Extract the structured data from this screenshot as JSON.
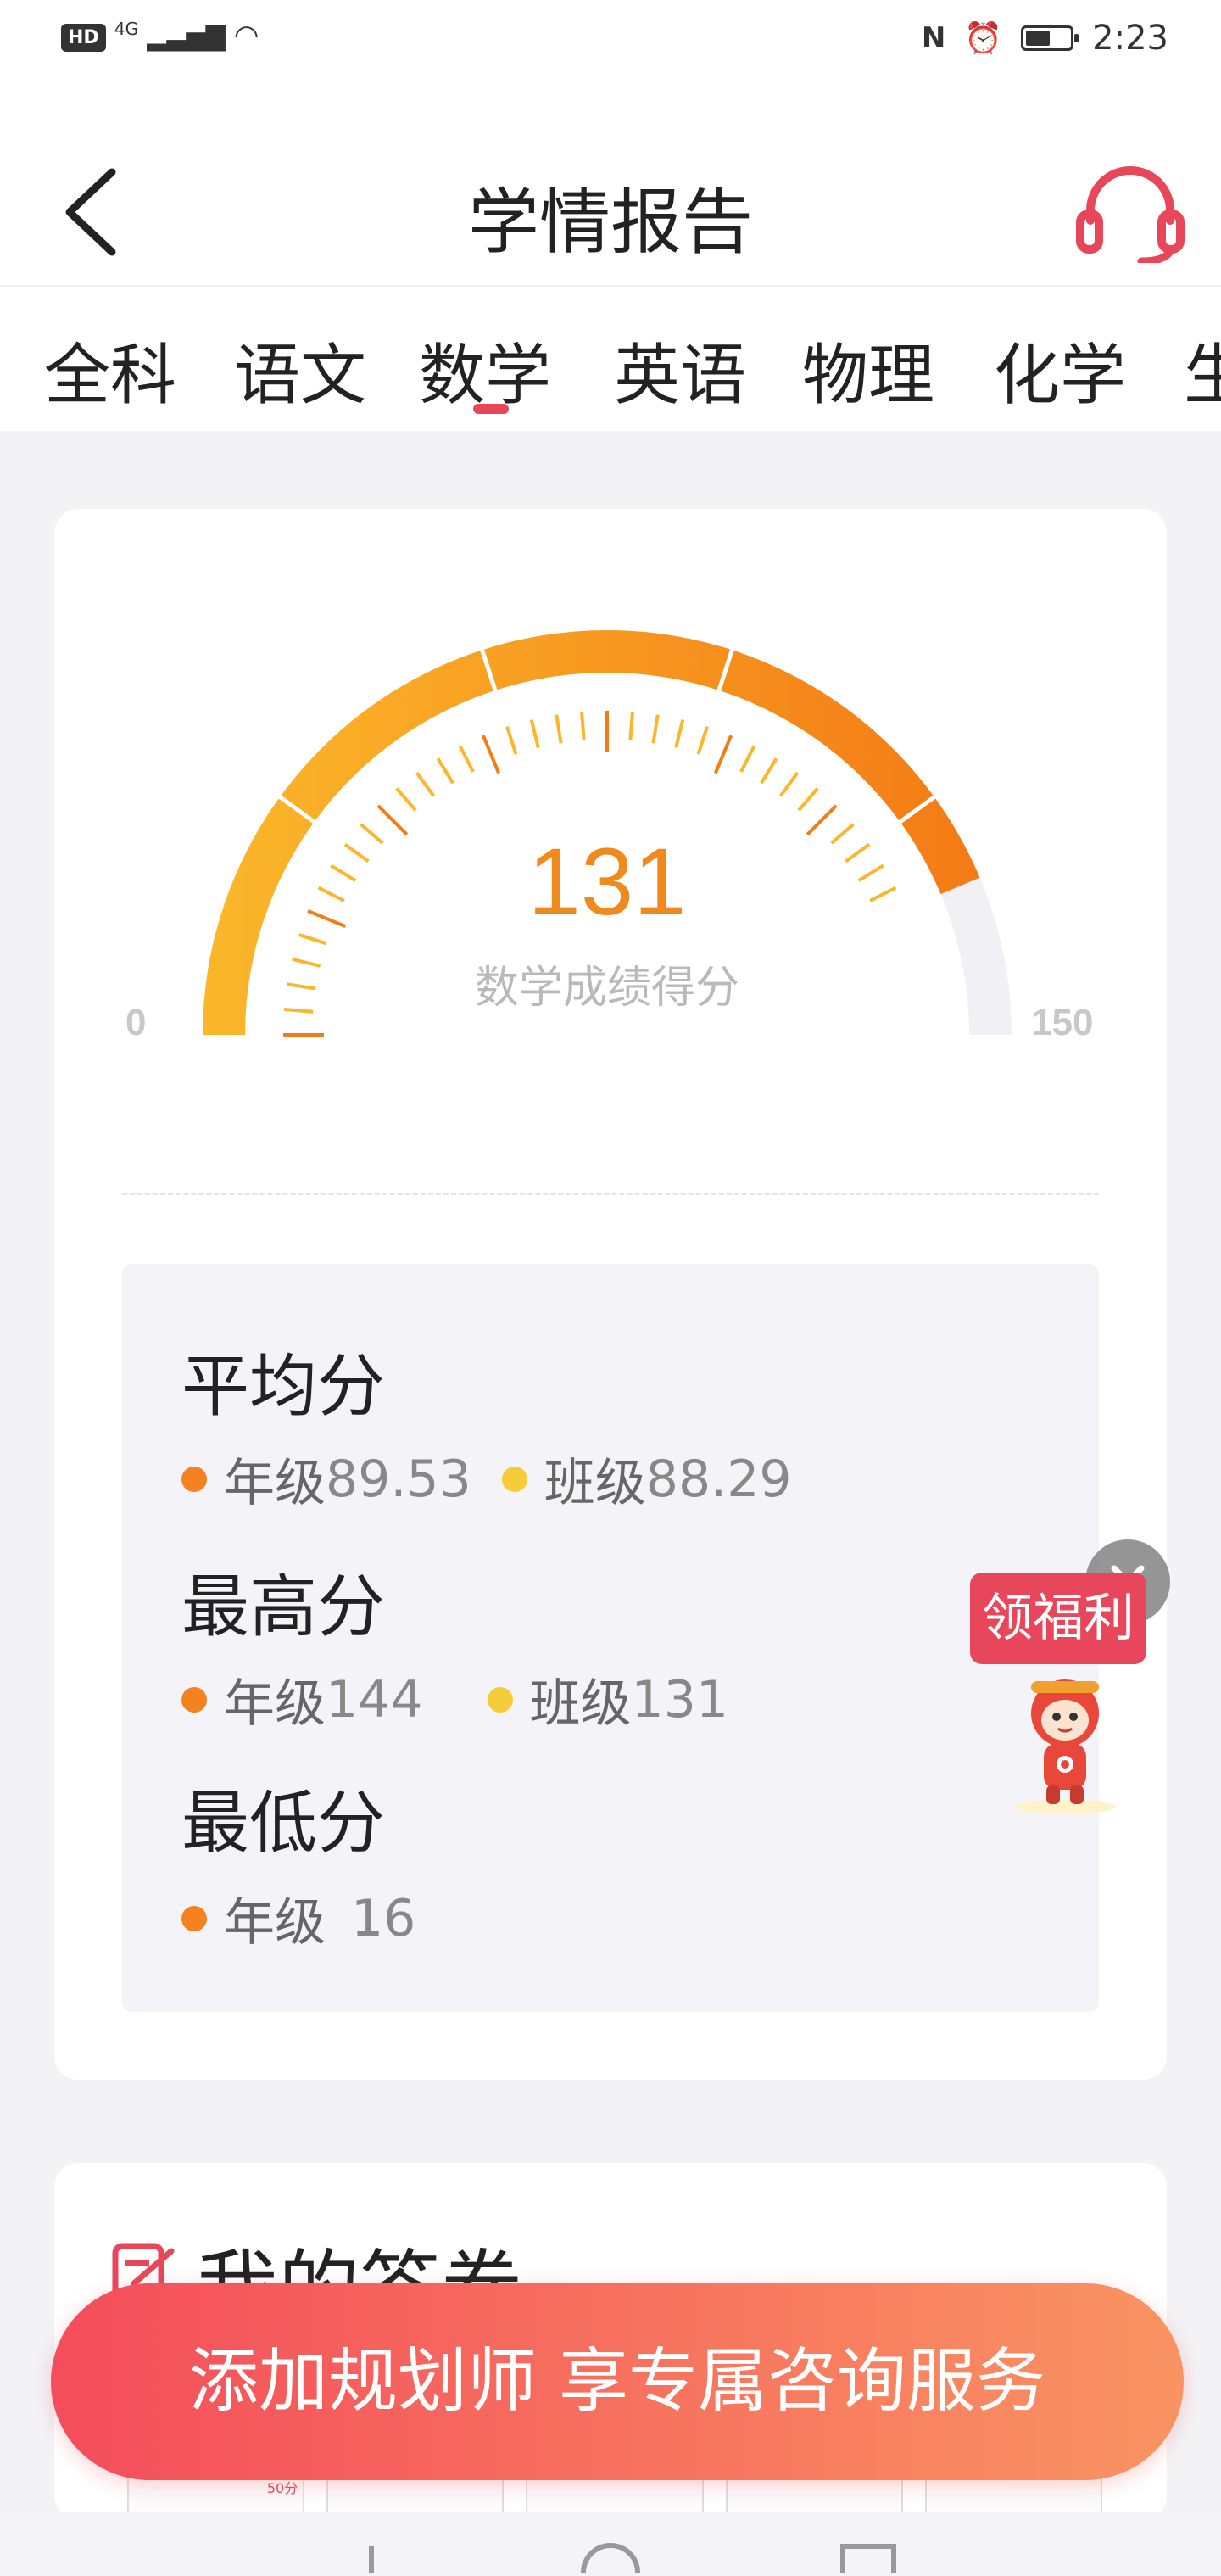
{
  "status_bar": {
    "network_badge": "HD",
    "network_type": "4G",
    "time": "2:23",
    "battery_level_percent": 55
  },
  "header": {
    "title": "学情报告"
  },
  "tabs": [
    {
      "label": "全科",
      "selected": false
    },
    {
      "label": "语文",
      "selected": false
    },
    {
      "label": "数学",
      "selected": true
    },
    {
      "label": "英语",
      "selected": false
    },
    {
      "label": "物理",
      "selected": false
    },
    {
      "label": "化学",
      "selected": false
    },
    {
      "label": "生",
      "selected": false
    }
  ],
  "score": {
    "value": "131",
    "caption": "数学成绩得分",
    "min_label": "0",
    "max_label": "150",
    "gauge_fraction": 0.873
  },
  "stats": {
    "average": {
      "heading": "平均分",
      "grade_label": "年级",
      "grade_value": "89.53",
      "class_label": "班级",
      "class_value": "88.29"
    },
    "highest": {
      "heading": "最高分",
      "grade_label": "年级",
      "grade_value": "144",
      "class_label": "班级",
      "class_value": "131"
    },
    "lowest": {
      "heading": "最低分",
      "grade_label": "年级",
      "grade_value": "16"
    }
  },
  "floating_reward": {
    "label": "领福利"
  },
  "answer_section": {
    "title": "我的答卷",
    "thumbnail_score": "50分"
  },
  "cta": {
    "label": "添加规划师 享专属咨询服务"
  },
  "colors": {
    "accent_red": "#e8475a",
    "gauge_orange_start": "#fbb62a",
    "gauge_orange_end": "#f47c16",
    "gauge_track": "#f1f1f5"
  }
}
